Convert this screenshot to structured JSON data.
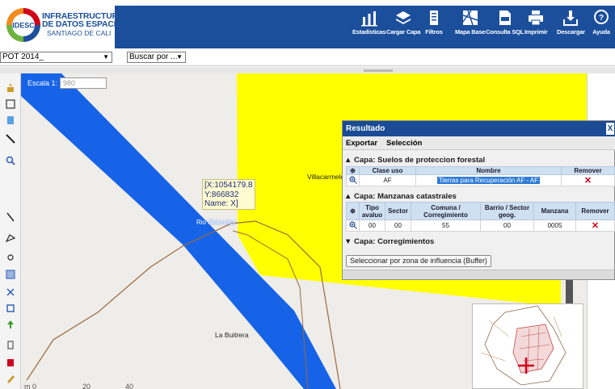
{
  "header": {
    "logo": {
      "badge_text": "IDESC",
      "line1": "INFRAESTRUCTURA",
      "line2": "DE DATOS ESPACIALES",
      "line3": "SANTIAGO DE CALI"
    },
    "toolbar": [
      {
        "id": "estadisticas",
        "label": "Estadísticas",
        "icon": "chart-icon"
      },
      {
        "id": "cargar-capa",
        "label": "Cargar Capa",
        "icon": "layers-icon"
      },
      {
        "id": "filtros",
        "label": "Filtros",
        "icon": "filter-icon"
      },
      {
        "id": "mapa-base",
        "label": "Mapa Base",
        "icon": "basemap-icon"
      },
      {
        "id": "consulta-sql",
        "label": "Consulta SQL",
        "icon": "sql-icon"
      },
      {
        "id": "imprimir",
        "label": "Imprimir",
        "icon": "printer-icon"
      },
      {
        "id": "descargar",
        "label": "Descargar",
        "icon": "download-icon"
      },
      {
        "id": "ayuda",
        "label": "Ayuda",
        "icon": "help-icon"
      }
    ],
    "colors": {
      "bar": "#1b4f9c",
      "accent_orange": "#f28c1e",
      "accent_red": "#d0021b"
    }
  },
  "controls": {
    "layer_select": "POT 2014_",
    "search_select": "Buscar por ..."
  },
  "map": {
    "scale_label": "Escala 1:",
    "scale_value": "980",
    "coord_tip": {
      "x": "[X:1054179.8",
      "y": "Y:866832",
      "name": "Name: X]"
    },
    "places": {
      "villacarmelo": "Villacarmelo",
      "rio": "Rio Melendez",
      "buitrera": "La Buitrera"
    },
    "scalebar": {
      "unit": "m",
      "t0": "0",
      "t1": "20",
      "t2": "40"
    },
    "colors": {
      "zone_yellow": "#ffff00",
      "river_blue": "#1663e8",
      "road_brown": "#9b6a3c",
      "background": "#efedea"
    }
  },
  "results": {
    "title": "Resultado",
    "close": "X",
    "menu": {
      "exportar": "Exportar",
      "seleccion": "Selección"
    },
    "layer1": {
      "heading": "▲ Capa: Suelos de proteccion forestal",
      "columns": {
        "clase_uso": "Clase uso",
        "nombre": "Nombre",
        "remover": "Remover"
      },
      "row": {
        "clase_uso": "AF",
        "nombre": "Tierras para Recuperación AF - AF"
      }
    },
    "layer2": {
      "heading": "▲ Capa: Manzanas catastrales",
      "columns": {
        "tipo_avaluo": "Tipo avaluo",
        "sector": "Sector",
        "comuna": "Comuna / Corregimiento",
        "barrio": "Barrio / Sector geog.",
        "manzana": "Manzana",
        "remover": "Remover"
      },
      "row": {
        "tipo_avaluo": "00",
        "sector": "00",
        "comuna": "55",
        "barrio": "00",
        "manzana": "0005"
      }
    },
    "layer3": {
      "heading": "▼ Capa: Corregimientos"
    },
    "buffer_button": "Seleccionar por zona de influencia (Buffer)",
    "remove_symbol": "✕"
  }
}
